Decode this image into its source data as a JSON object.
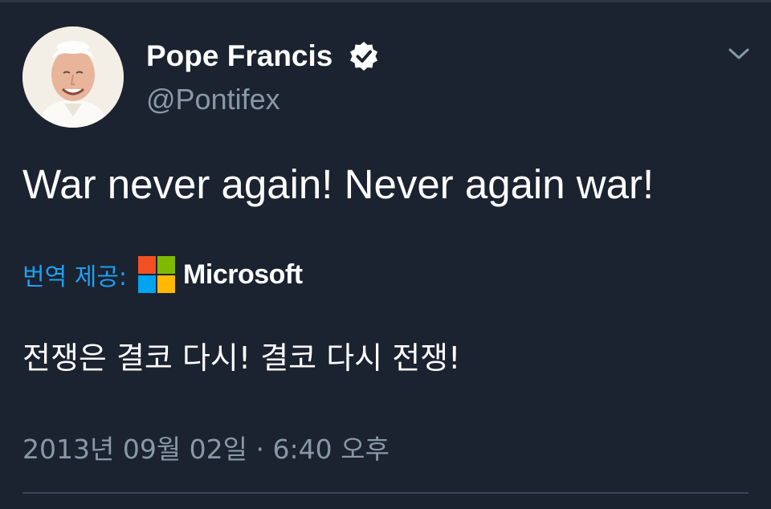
{
  "tweet": {
    "author": {
      "display_name": "Pope Francis",
      "handle": "@Pontifex",
      "verified": true
    },
    "text": "War never again! Never again war!",
    "translation": {
      "label": "번역 제공:",
      "provider": "Microsoft",
      "text": "전쟁은 결코 다시! 결코 다시 전쟁!"
    },
    "timestamp": "2013년 09월 02일 · 6:40 오후"
  },
  "icons": {
    "verified": "verified-badge-icon",
    "caret": "chevron-down-icon",
    "provider_logo": "microsoft-logo-icon"
  },
  "colors": {
    "background": "#1b2230",
    "primary_text": "#ffffff",
    "secondary_text": "#8899a6",
    "link": "#1da1f2",
    "ms_red": "#f25022",
    "ms_green": "#7fba00",
    "ms_blue": "#00a4ef",
    "ms_yellow": "#ffb900"
  }
}
